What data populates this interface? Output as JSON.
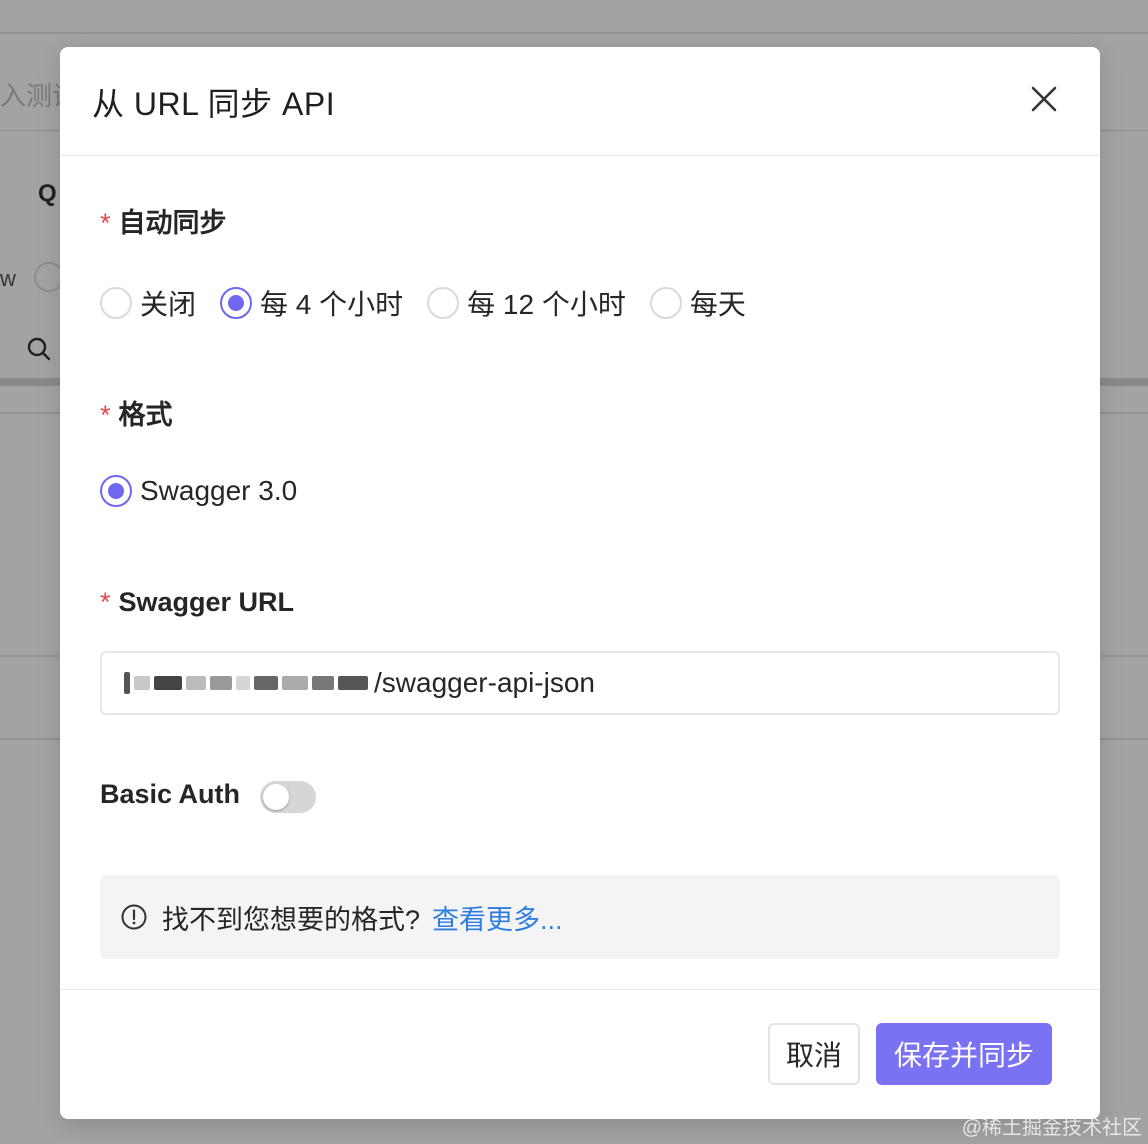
{
  "background": {
    "search_placeholder_partial": "入测试",
    "label_q": "Q",
    "label_w": "w"
  },
  "modal": {
    "title": "从 URL 同步 API",
    "close_icon": "close-icon",
    "auto_sync": {
      "label": "自动同步",
      "required_mark": "*",
      "options": [
        "关闭",
        "每 4 个小时",
        "每 12 个小时",
        "每天"
      ],
      "selected": "每 4 个小时"
    },
    "format": {
      "label": "格式",
      "required_mark": "*",
      "options": [
        "Swagger 3.0"
      ],
      "selected": "Swagger 3.0"
    },
    "swagger_url": {
      "label": "Swagger URL",
      "required_mark": "*",
      "value_visible_suffix": "/swagger-api-json"
    },
    "basic_auth": {
      "label": "Basic Auth",
      "enabled": false
    },
    "info": {
      "icon": "info-circle-icon",
      "text": "找不到您想要的格式?",
      "link": "查看更多..."
    },
    "buttons": {
      "cancel": "取消",
      "submit": "保存并同步"
    }
  },
  "watermark": "@稀土掘金技术社区",
  "colors": {
    "accent": "#7067f0",
    "primary_button": "#7a72f2",
    "link": "#2f7de1",
    "required": "#e5484d"
  }
}
